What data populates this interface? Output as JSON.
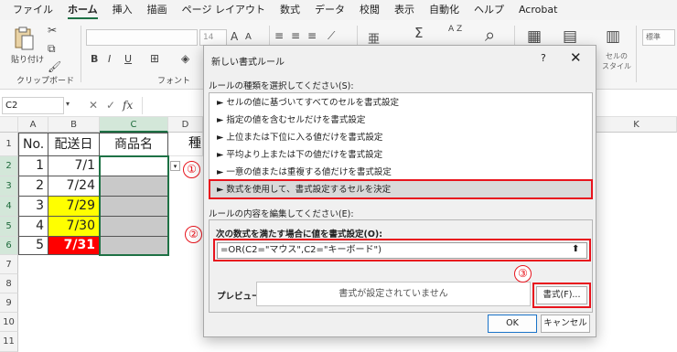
{
  "menu": [
    "ファイル",
    "ホーム",
    "挿入",
    "描画",
    "ページ レイアウト",
    "数式",
    "データ",
    "校閲",
    "表示",
    "自動化",
    "ヘルプ",
    "Acrobat"
  ],
  "ribbon": {
    "paste_label": "貼り付け",
    "clipboard_label": "クリップボード",
    "font_label": "フォント",
    "font_size": "14",
    "increase_font": "A",
    "decrease_font": "A",
    "bold": "B",
    "italic": "I",
    "underline": "U",
    "standard_label": "標準",
    "style_label": "セルの\nスタイル",
    "sigma": "Σ",
    "sort": "A Z"
  },
  "formula_bar": {
    "namebox": "C2",
    "fx": "fx"
  },
  "sheet": {
    "columns": [
      "A",
      "B",
      "C",
      "D",
      "K"
    ],
    "rows": [
      "1",
      "2",
      "3",
      "4",
      "5",
      "6",
      "7",
      "8",
      "9",
      "10",
      "11"
    ],
    "header": {
      "no": "No.",
      "date": "配送日",
      "product": "商品名",
      "extra": "種"
    },
    "data": [
      {
        "no": "1",
        "date": "7/1"
      },
      {
        "no": "2",
        "date": "7/24"
      },
      {
        "no": "3",
        "date": "7/29"
      },
      {
        "no": "4",
        "date": "7/30"
      },
      {
        "no": "5",
        "date": "7/31"
      }
    ]
  },
  "dialog": {
    "title": "新しい書式ルール",
    "help": "?",
    "close": "✕",
    "rule_type_label": "ルールの種類を選択してください(S):",
    "rule_types": [
      "► セルの値に基づいてすべてのセルを書式設定",
      "► 指定の値を含むセルだけを書式設定",
      "► 上位または下位に入る値だけを書式設定",
      "► 平均より上または下の値だけを書式設定",
      "► 一意の値または重複する値だけを書式設定",
      "► 数式を使用して、書式設定するセルを決定"
    ],
    "edit_label": "ルールの内容を編集してください(E):",
    "formula_label": "次の数式を満たす場合に値を書式設定(O):",
    "formula": "=OR(C2=\"マウス\",C2=\"キーボード\")",
    "preview_label": "プレビュー:",
    "preview_text": "書式が設定されていません",
    "format_button": "書式(F)...",
    "ok": "OK",
    "cancel": "キャンセル"
  },
  "markers": [
    "①",
    "②",
    "③"
  ],
  "colors": {
    "highlight_yellow": "#ffff00",
    "highlight_red": "#ff0000",
    "marker_red": "#e8141d",
    "accent_green": "#1e7145"
  }
}
